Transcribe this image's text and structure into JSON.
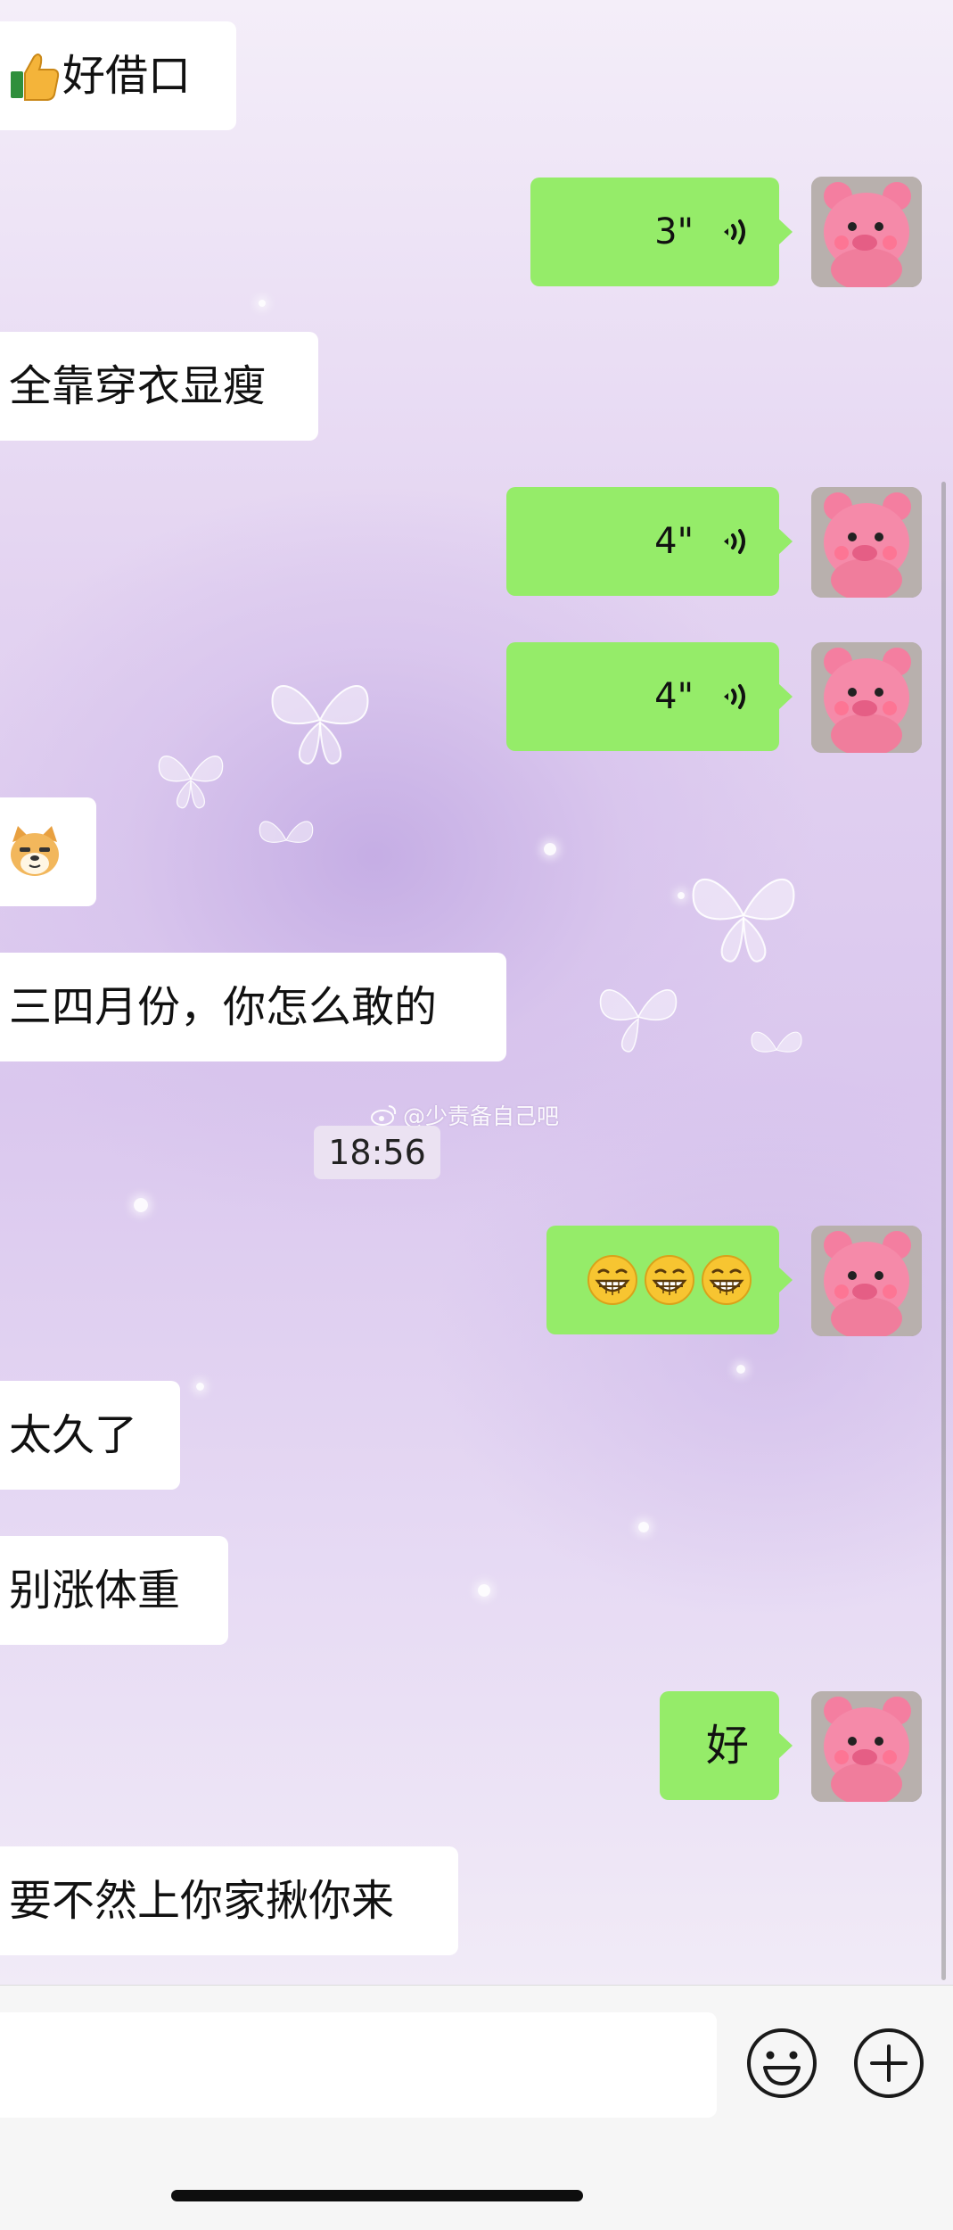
{
  "chat": {
    "watermark": "@少责备自己吧",
    "timestamp": "18:56",
    "messages": [
      {
        "side": "in",
        "type": "text",
        "emoji_prefix": "thumbs-up-icon",
        "text": "好借口"
      },
      {
        "side": "out",
        "type": "voice",
        "duration": "3\""
      },
      {
        "side": "in",
        "type": "text",
        "text": "全靠穿衣显瘦"
      },
      {
        "side": "out",
        "type": "voice",
        "duration": "4\""
      },
      {
        "side": "out",
        "type": "voice",
        "duration": "4\""
      },
      {
        "side": "in",
        "type": "sticker",
        "icon": "doge-emoji-icon"
      },
      {
        "side": "in",
        "type": "text",
        "text": "三四月份，你怎么敢的"
      },
      {
        "side": "out",
        "type": "emoji",
        "icons": [
          "grin-emoji-icon",
          "grin-emoji-icon",
          "grin-emoji-icon"
        ]
      },
      {
        "side": "in",
        "type": "text",
        "text": "太久了"
      },
      {
        "side": "in",
        "type": "text",
        "text": "别涨体重"
      },
      {
        "side": "out",
        "type": "text",
        "text": "好"
      },
      {
        "side": "in",
        "type": "text",
        "text": "要不然上你家揪你来"
      }
    ]
  },
  "input_bar": {
    "value": "",
    "emoji_button": "smiley-icon",
    "more_button": "plus-circle-icon"
  },
  "colors": {
    "outgoing_bubble": "#95ec69",
    "incoming_bubble": "#ffffff",
    "background": "#dac7ee"
  }
}
